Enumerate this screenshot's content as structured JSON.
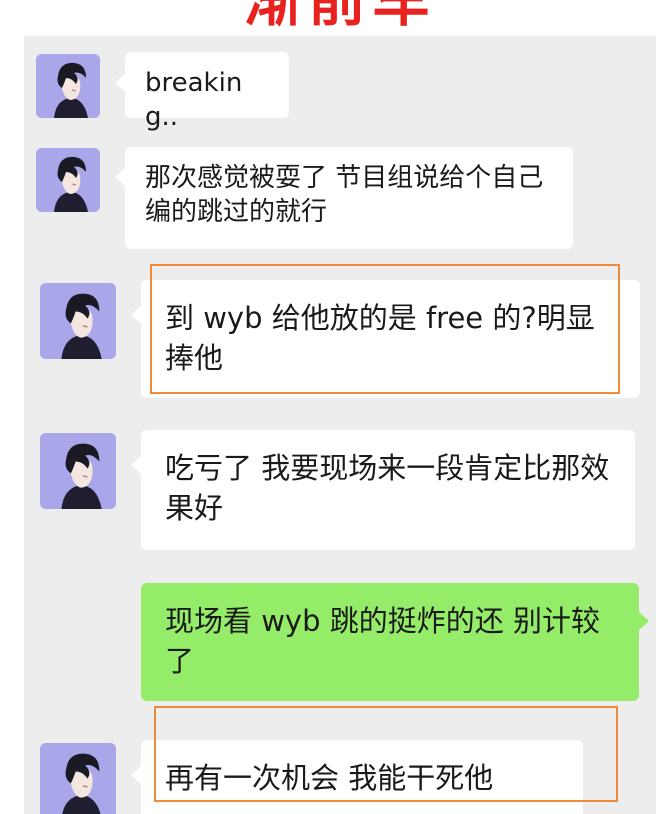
{
  "header": {
    "title": "渐前车"
  },
  "messages": [
    {
      "side": "left",
      "text": "breaking..",
      "avatar_icon": "illustrated-man-profile-icon"
    },
    {
      "side": "left",
      "text": "那次感觉被耍了 节目组说给个自己编的跳过的就行",
      "avatar_icon": "illustrated-man-profile-icon"
    },
    {
      "side": "left",
      "text": "到 wyb 给他放的是 free 的?明显捧他",
      "avatar_icon": "illustrated-man-profile-icon",
      "highlighted": true
    },
    {
      "side": "left",
      "text": "吃亏了  我要现场来一段肯定比那效果好",
      "avatar_icon": "illustrated-man-profile-icon"
    },
    {
      "side": "right",
      "text": "现场看 wyb 跳的挺炸的还  别计较了"
    },
    {
      "side": "left",
      "text": "再有一次机会   我能干死他",
      "avatar_icon": "illustrated-man-profile-icon",
      "highlighted": true
    }
  ],
  "colors": {
    "chat_background": "#ededed",
    "incoming_bubble": "#ffffff",
    "outgoing_bubble": "#95ec69",
    "highlight_border": "#ef8a3a",
    "title_red": "#e8231f",
    "avatar_background": "#a9a6ea"
  }
}
